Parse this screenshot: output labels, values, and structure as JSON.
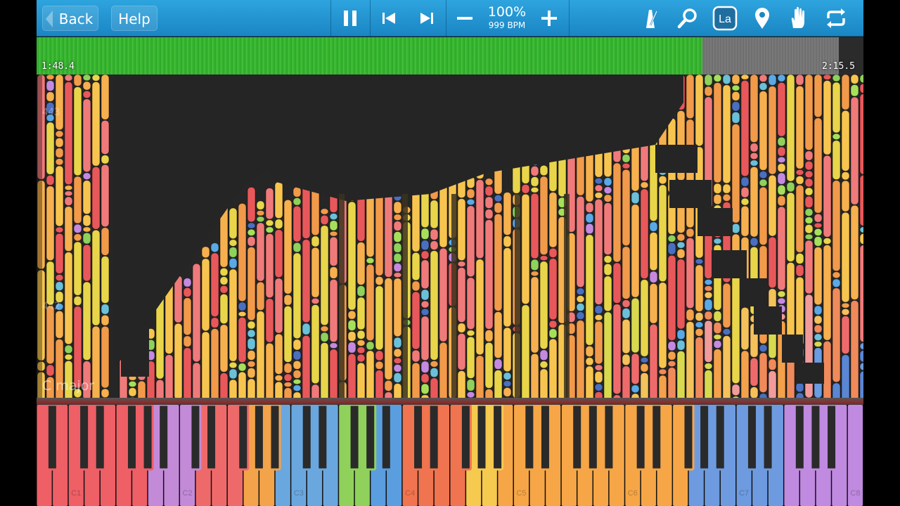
{
  "toolbar": {
    "back_label": "Back",
    "help_label": "Help",
    "speed_percent": "100%",
    "speed_bpm": "999 BPM",
    "icons": [
      "pause-icon",
      "skip-back-icon",
      "skip-forward-icon",
      "minus-icon",
      "plus-icon",
      "metronome-icon",
      "zoom-icon",
      "label-icon",
      "marker-icon",
      "hand-icon",
      "loop-icon"
    ],
    "label_button_text": "La"
  },
  "timeline": {
    "current_time": "1:48.4",
    "total_time": "2:15.5",
    "progress": 0.8
  },
  "notes_area": {
    "measure_numbers": [
      "443",
      "442"
    ],
    "key_signature": "C major"
  },
  "keyboard": {
    "octave_labels": [
      "C1",
      "C2",
      "C3",
      "C4",
      "C5",
      "C6",
      "C7",
      "C8"
    ]
  },
  "colors": {
    "toolbar_top": "#2ea4df",
    "toolbar_bottom": "#1a86c4",
    "timeline_green": "#35b52e",
    "background": "#262626"
  }
}
